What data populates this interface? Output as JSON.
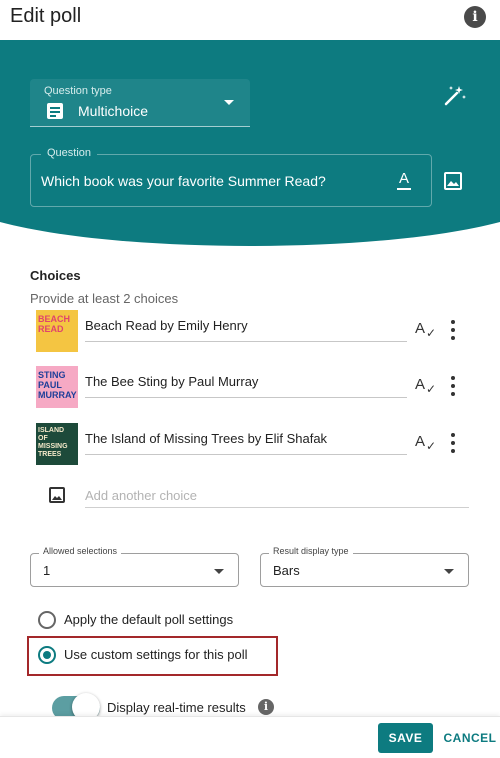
{
  "header": {
    "title": "Edit poll",
    "info_icon": "info-icon"
  },
  "colors": {
    "teal": "#0d7b80",
    "accent_red": "#a3282a"
  },
  "question_type": {
    "label": "Question type",
    "value": "Multichoice",
    "icon": "poll-list-icon"
  },
  "question": {
    "label": "Question",
    "value": "Which book was your favorite Summer Read?",
    "format_icon": "text-format-icon",
    "image_icon": "image-icon"
  },
  "magic_icon": "magic-wand-icon",
  "choices": {
    "title": "Choices",
    "hint": "Provide at least 2 choices",
    "items": [
      {
        "text": "Beach Read by Emily Henry",
        "cover": "BEACH READ",
        "cover_bg": "#f4c542",
        "cover_fg": "#e0446c"
      },
      {
        "text": "The Bee Sting by Paul Murray",
        "cover": "STING PAUL MURRAY",
        "cover_bg": "#f6a9c4",
        "cover_fg": "#1f3f99"
      },
      {
        "text": "The Island of Missing Trees by Elif Shafak",
        "cover": "ISLAND OF MISSING TREES",
        "cover_bg": "#1d4a3a",
        "cover_fg": "#f4e9c9"
      }
    ],
    "add_placeholder": "Add another choice"
  },
  "allowed_selections": {
    "label": "Allowed selections",
    "value": "1"
  },
  "result_display": {
    "label": "Result display type",
    "value": "Bars"
  },
  "settings": {
    "default_label": "Apply the default poll settings",
    "custom_label": "Use custom settings for this poll",
    "selected": "custom"
  },
  "realtime": {
    "label": "Display real-time results",
    "on": true
  },
  "footer": {
    "save": "SAVE",
    "cancel": "CANCEL"
  }
}
